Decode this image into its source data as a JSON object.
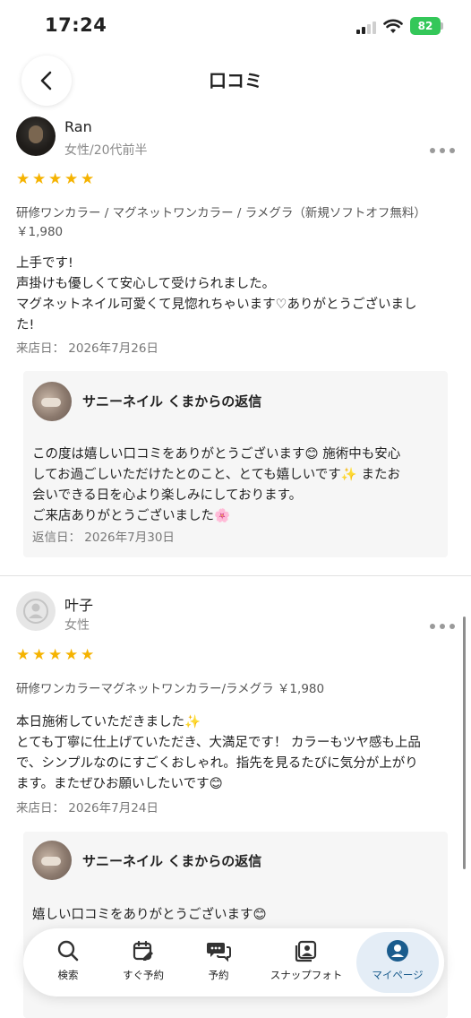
{
  "status_bar": {
    "time": "17:24",
    "battery": "82"
  },
  "header": {
    "title": "口コミ"
  },
  "reviews": [
    {
      "name": "Ran",
      "meta": "女性/20代前半",
      "rating": 5,
      "menu": "研修ワンカラー / マグネットワンカラー / ラメグラ（新規ソフトオフ無料）",
      "price": "￥1,980",
      "text": "上手です!\n声掛けも優しくて安心して受けられました。\nマグネットネイル可愛くて見惚れちゃいます♡ありがとうございまし\nた!",
      "visit_date": "来店日： 2026年7月26日",
      "reply": {
        "title": "サニーネイル くまからの返信",
        "text": "この度は嬉しい口コミをありがとうございます😊 施術中も安心\nしてお過ごしいただけたとのこと、とても嬉しいです✨ またお\n会いできる日を心より楽しみにしております。\nご来店ありがとうございました🌸",
        "date": "返信日： 2026年7月30日"
      }
    },
    {
      "name": "叶子",
      "meta": "女性",
      "rating": 5,
      "menu": "研修ワンカラーマグネットワンカラー/ラメグラ ￥1,980",
      "text": "本日施術していただきました✨\nとても丁寧に仕上げていただき、大満足です！ カラーもツヤ感も上品\nで、シンプルなのにすごくおしゃれ。指先を見るたびに気分が上がり\nます。またぜひお願いしたいです😊",
      "visit_date": "来店日： 2026年7月24日",
      "reply": {
        "title": "サニーネイル くまからの返信",
        "text": "嬉しい口コミをありがとうございます😊"
      }
    }
  ],
  "nav": {
    "items": [
      {
        "label": "検索",
        "icon": "search-icon"
      },
      {
        "label": "すぐ予約",
        "icon": "calendar-edit-icon"
      },
      {
        "label": "予約",
        "icon": "chat-bubbles-icon"
      },
      {
        "label": "スナップフォト",
        "icon": "photo-album-icon"
      },
      {
        "label": "マイページ",
        "icon": "user-circle-icon"
      }
    ],
    "active": "マイページ",
    "active_color": "#1a5c8d"
  },
  "colors": {
    "star": "#f5b301",
    "battery": "#34c759",
    "reply_bg": "#f6f6f6"
  }
}
